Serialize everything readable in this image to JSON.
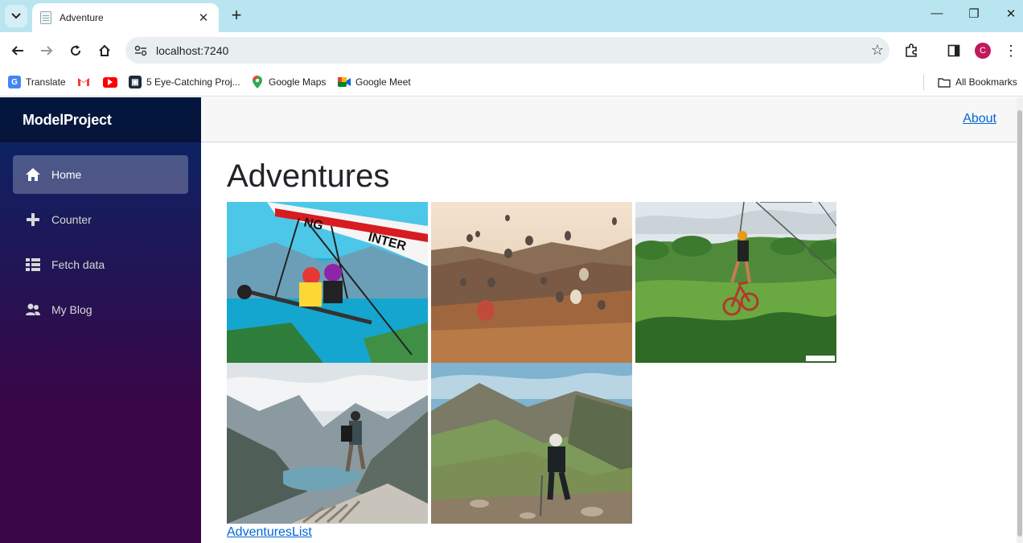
{
  "browser": {
    "tab_title": "Adventure",
    "tab_close": "✕",
    "new_tab": "+",
    "url": "localhost:7240",
    "profile_initial": "C",
    "bookmarks": [
      {
        "label": "Translate"
      },
      {
        "label": ""
      },
      {
        "label": ""
      },
      {
        "label": "5 Eye-Catching Proj..."
      },
      {
        "label": "Google Maps"
      },
      {
        "label": "Google Meet"
      }
    ],
    "all_bookmarks": "All Bookmarks"
  },
  "app": {
    "brand": "ModelProject",
    "nav": [
      {
        "label": "Home",
        "icon": "home-icon",
        "active": true
      },
      {
        "label": "Counter",
        "icon": "plus-icon",
        "active": false
      },
      {
        "label": "Fetch data",
        "icon": "list-icon",
        "active": false
      },
      {
        "label": "My Blog",
        "icon": "people-icon",
        "active": false
      }
    ],
    "about_link": "About",
    "page_title": "Adventures",
    "photos": [
      {
        "icon": "hang-gliding-photo"
      },
      {
        "icon": "hot-air-balloons-photo"
      },
      {
        "icon": "zipline-bike-photo"
      },
      {
        "icon": "mountain-lake-hiker-photo"
      },
      {
        "icon": "valley-hiker-photo"
      }
    ],
    "adventures_list_link": "AdventuresList"
  },
  "colors": {
    "sidebar_top": "#052767",
    "sidebar_bottom": "#3a0647",
    "link": "#0366d6",
    "tabstrip": "#b9e5f0"
  }
}
